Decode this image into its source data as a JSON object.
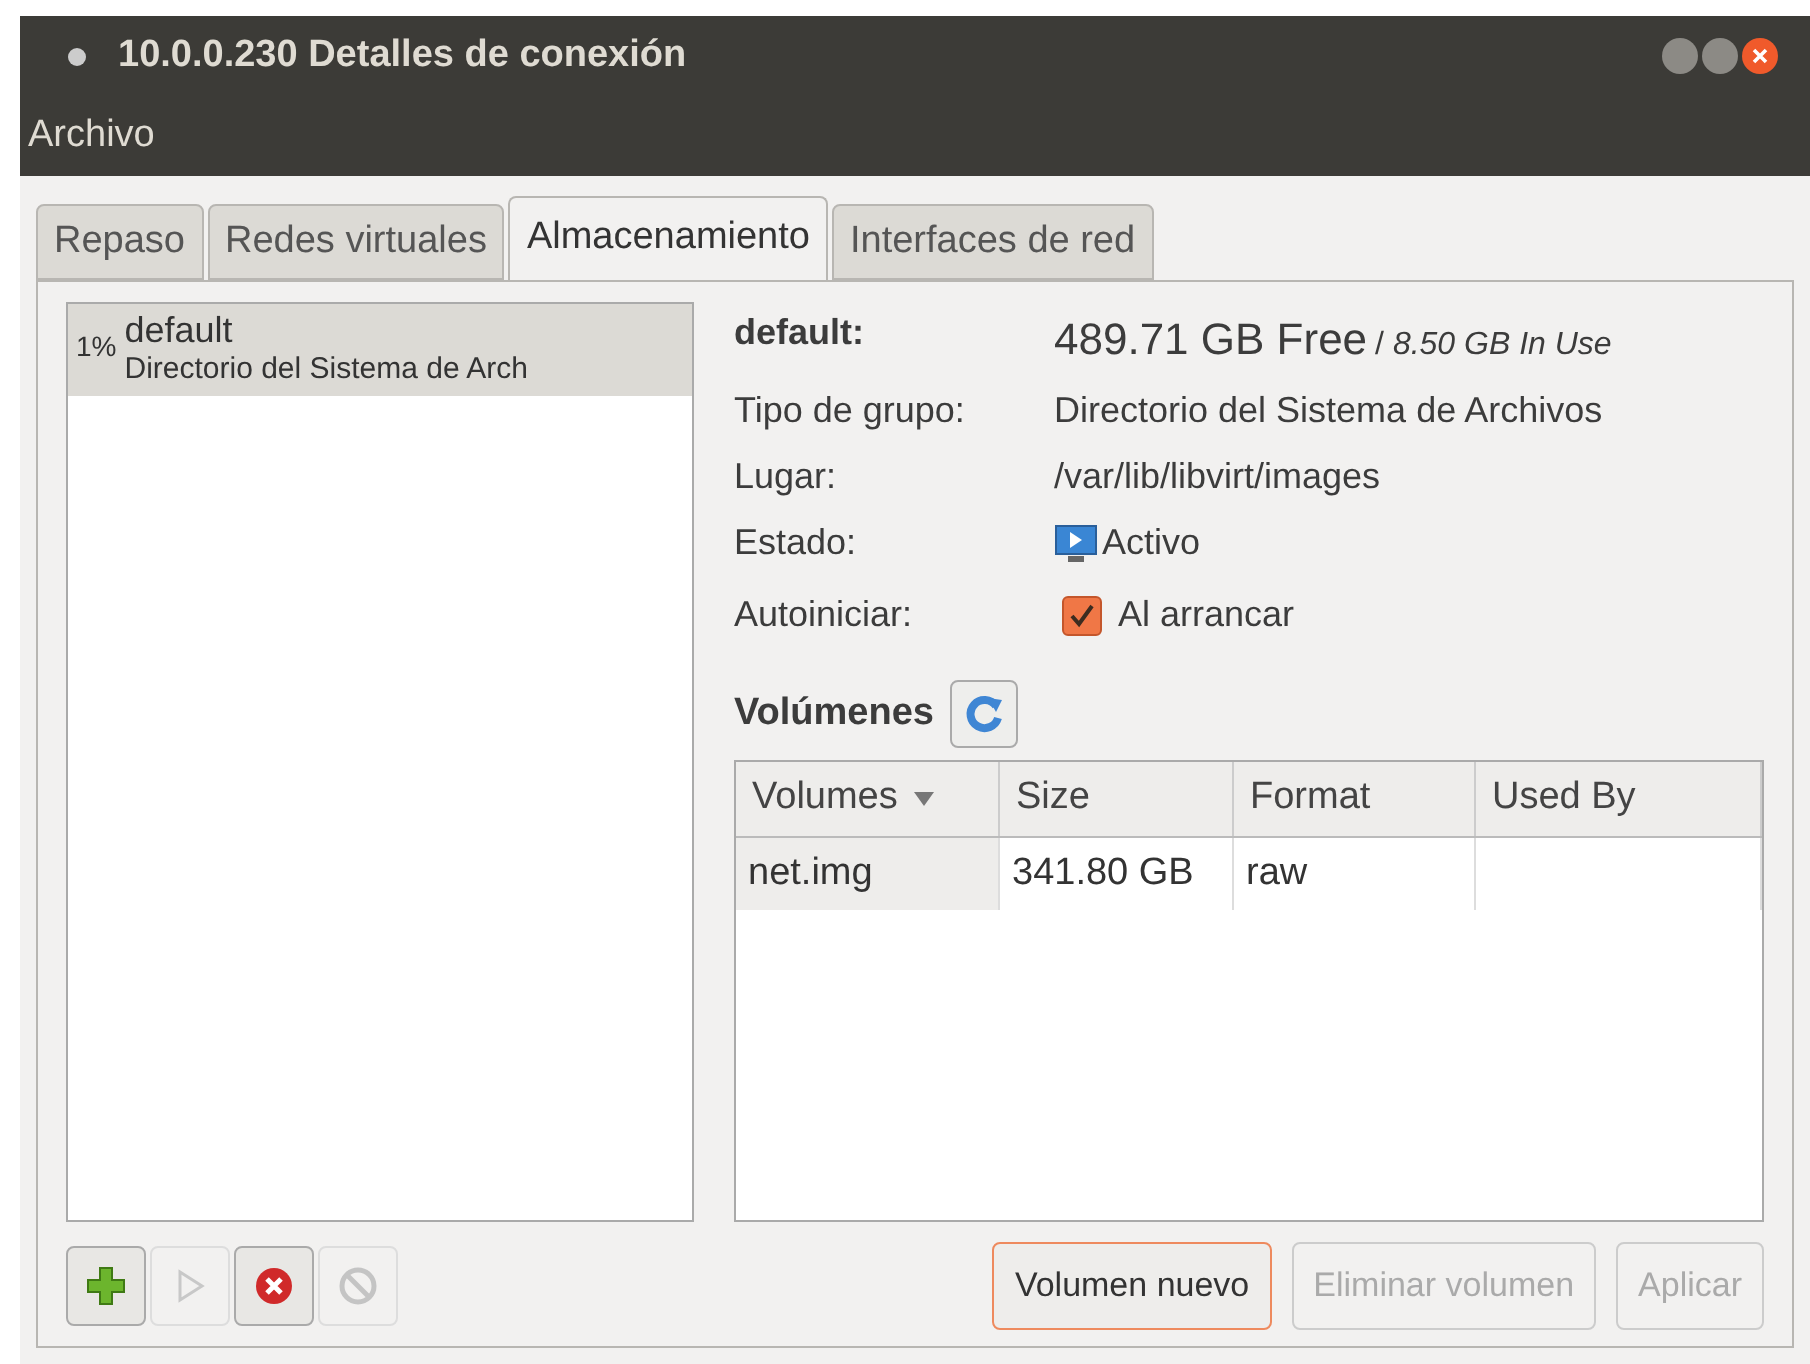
{
  "window": {
    "title": "10.0.0.230 Detalles de conexión"
  },
  "menu": [
    "Archivo"
  ],
  "tabs": [
    {
      "label": "Repaso",
      "selected": false
    },
    {
      "label": "Redes virtuales",
      "selected": false
    },
    {
      "label": "Almacenamiento",
      "selected": true
    },
    {
      "label": "Interfaces de red",
      "selected": false
    }
  ],
  "pools": [
    {
      "usage": "1%",
      "name": "default",
      "type": "Directorio del Sistema de Arch",
      "selected": true
    }
  ],
  "pool_buttons": [
    {
      "kind": "add",
      "disabled": false
    },
    {
      "kind": "start",
      "disabled": true
    },
    {
      "kind": "stop",
      "disabled": false
    },
    {
      "kind": "delete",
      "disabled": true
    }
  ],
  "details": {
    "name": "default:",
    "free": "489.71 GB Free",
    "in_use": "/ *8.50 GB In Use*",
    "rows": [
      {
        "label": "Tipo de grupo:",
        "value": "Directorio del Sistema de Archivos",
        "kind": "text"
      },
      {
        "label": "Lugar:",
        "value": "/var/lib/libvirt/images",
        "kind": "text"
      },
      {
        "label": "Estado:",
        "value": "Activo",
        "kind": "status"
      },
      {
        "label": "Autoiniciar:",
        "value": "Al arrancar",
        "kind": "checkbox",
        "checked": true
      }
    ]
  },
  "volumes": {
    "title": "Volúmenes",
    "columns": [
      "Volumes",
      "Size",
      "Format",
      "Used By"
    ],
    "rows": [
      [
        "net.img",
        "341.80 GB",
        "raw",
        ""
      ]
    ]
  },
  "buttons": [
    {
      "label": "Volumen nuevo",
      "disabled": false,
      "focused": true
    },
    {
      "label": "Eliminar volumen",
      "disabled": true,
      "focused": false
    },
    {
      "label": "Aplicar",
      "disabled": true,
      "focused": false
    }
  ]
}
